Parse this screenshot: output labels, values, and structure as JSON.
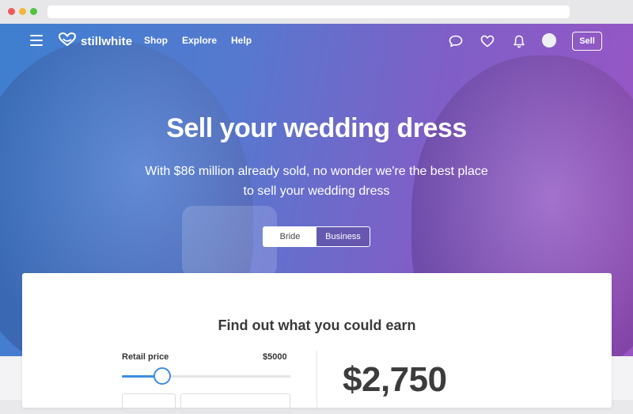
{
  "brand": {
    "name": "stillwhite"
  },
  "nav": {
    "links": [
      "Shop",
      "Explore",
      "Help"
    ],
    "sell_label": "Sell"
  },
  "hero": {
    "title": "Sell your wedding dress",
    "subtitle": "With $86 million already sold, no wonder we're the best place to sell your wedding dress",
    "toggle": {
      "options": [
        "Bride",
        "Business"
      ],
      "selected": "Bride"
    }
  },
  "calculator": {
    "title": "Find out what you could earn",
    "retail_label": "Retail price",
    "retail_value": "$5000",
    "slider_fraction": 0.24,
    "earnings": "$2,750"
  },
  "colors": {
    "hero_left": "#3f7fd0",
    "hero_right": "#9a55c4",
    "accent": "#3e8ee0"
  },
  "icons": [
    "menu-icon",
    "heart-logo-icon",
    "chat-icon",
    "heart-icon",
    "bell-icon",
    "avatar"
  ]
}
